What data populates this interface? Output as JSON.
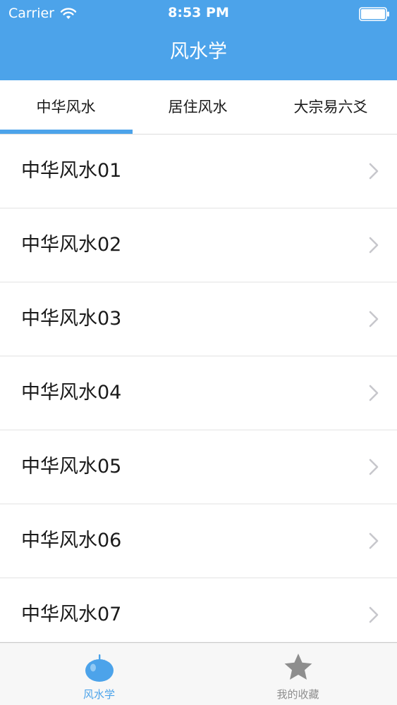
{
  "status_bar": {
    "carrier": "Carrier",
    "time": "8:53 PM",
    "wifi_icon": "wifi-icon",
    "battery_icon": "battery-icon"
  },
  "nav": {
    "title": "风水学"
  },
  "tabs": [
    {
      "label": "中华风水",
      "selected": true
    },
    {
      "label": "居住风水",
      "selected": false
    },
    {
      "label": "大宗易六爻",
      "selected": false
    }
  ],
  "list": {
    "items": [
      {
        "label": "中华风水01"
      },
      {
        "label": "中华风水02"
      },
      {
        "label": "中华风水03"
      },
      {
        "label": "中华风水04"
      },
      {
        "label": "中华风水05"
      },
      {
        "label": "中华风水06"
      },
      {
        "label": "中华风水07"
      }
    ],
    "row_icon": "chevron-right-icon"
  },
  "tabbar": {
    "items": [
      {
        "label": "风水学",
        "icon": "tomato-icon",
        "selected": true
      },
      {
        "label": "我的收藏",
        "icon": "star-icon",
        "selected": false
      }
    ]
  },
  "colors": {
    "accent": "#4ca3ea",
    "inactive": "#8e8e8e",
    "background": "#f3f3f4"
  }
}
